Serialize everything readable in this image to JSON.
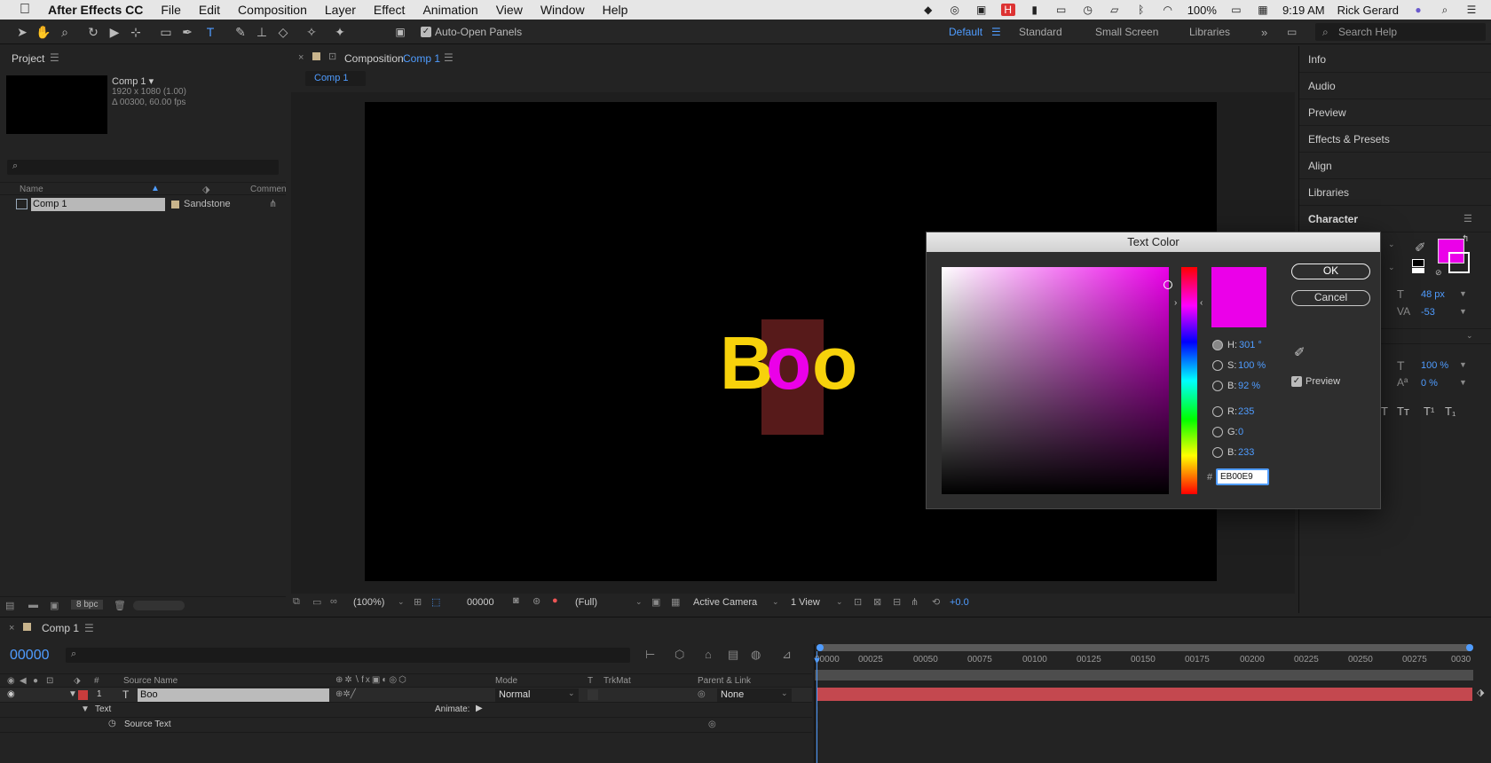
{
  "menubar": {
    "apple": "",
    "app": "After Effects CC",
    "items": [
      "File",
      "Edit",
      "Composition",
      "Layer",
      "Effect",
      "Animation",
      "View",
      "Window",
      "Help"
    ],
    "battery": "100%",
    "time": "9:19 AM",
    "user": "Rick Gerard"
  },
  "toolbar": {
    "auto_open_panels": "Auto-Open Panels",
    "workspaces": [
      "Default",
      "Standard",
      "Small Screen",
      "Libraries"
    ],
    "active_workspace": "Default",
    "search_placeholder": "Search Help"
  },
  "project": {
    "title": "Project",
    "comp_name": "Comp 1 ▾",
    "comp_size": "1920 x 1080 (1.00)",
    "comp_duration": "Δ 00300, 60.00 fps",
    "columns": {
      "name": "Name",
      "comment": "Commen"
    },
    "item": {
      "name": "Comp 1",
      "label": "Sandstone"
    },
    "bpc": "8 bpc"
  },
  "composition": {
    "panel_title": "Composition",
    "comp_name": "Comp 1",
    "tab": "Comp 1",
    "text_chars": [
      "B",
      "o",
      "o"
    ],
    "zoom": "(100%)",
    "timecode": "00000",
    "resolution": "(Full)",
    "camera": "Active Camera",
    "views": "1 View",
    "exposure": "+0.0"
  },
  "right_panels": {
    "items": [
      "Info",
      "Audio",
      "Preview",
      "Effects & Presets",
      "Align",
      "Libraries"
    ],
    "character": "Character",
    "font_size": "48 px",
    "tracking": "-53",
    "vert_scale": "100 %",
    "baseline": "0 %",
    "styles": [
      "T",
      "Tт",
      "T¹",
      "T₁"
    ]
  },
  "dialog": {
    "title": "Text Color",
    "hue": "301 °",
    "saturation": "100 %",
    "brightness": "92 %",
    "red": "235",
    "green": "0",
    "blue": "233",
    "hex": "EB00E9",
    "ok": "OK",
    "cancel": "Cancel",
    "preview": "Preview",
    "labels": {
      "h": "H:",
      "s": "S:",
      "b": "B:",
      "r": "R:",
      "g": "G:",
      "bb": "B:"
    }
  },
  "timeline": {
    "tab": "Comp 1",
    "timecode": "00000",
    "columns": {
      "num": "#",
      "source": "Source Name",
      "mode": "Mode",
      "t": "T",
      "trkmat": "TrkMat",
      "parent": "Parent & Link"
    },
    "layer": {
      "index": "1",
      "name": "Boo",
      "mode": "Normal",
      "parent": "None"
    },
    "text_group": "Text",
    "animate": "Animate:",
    "source_text": "Source Text",
    "ruler": [
      "00000",
      "00025",
      "00050",
      "00075",
      "00100",
      "00125",
      "00150",
      "00175",
      "00200",
      "00225",
      "00250",
      "00275",
      "0030"
    ]
  },
  "colors": {
    "accent": "#4f9cff",
    "text_yellow": "#f7d20b",
    "text_pink": "#eb00e9",
    "layer_bar": "#c4484f"
  }
}
